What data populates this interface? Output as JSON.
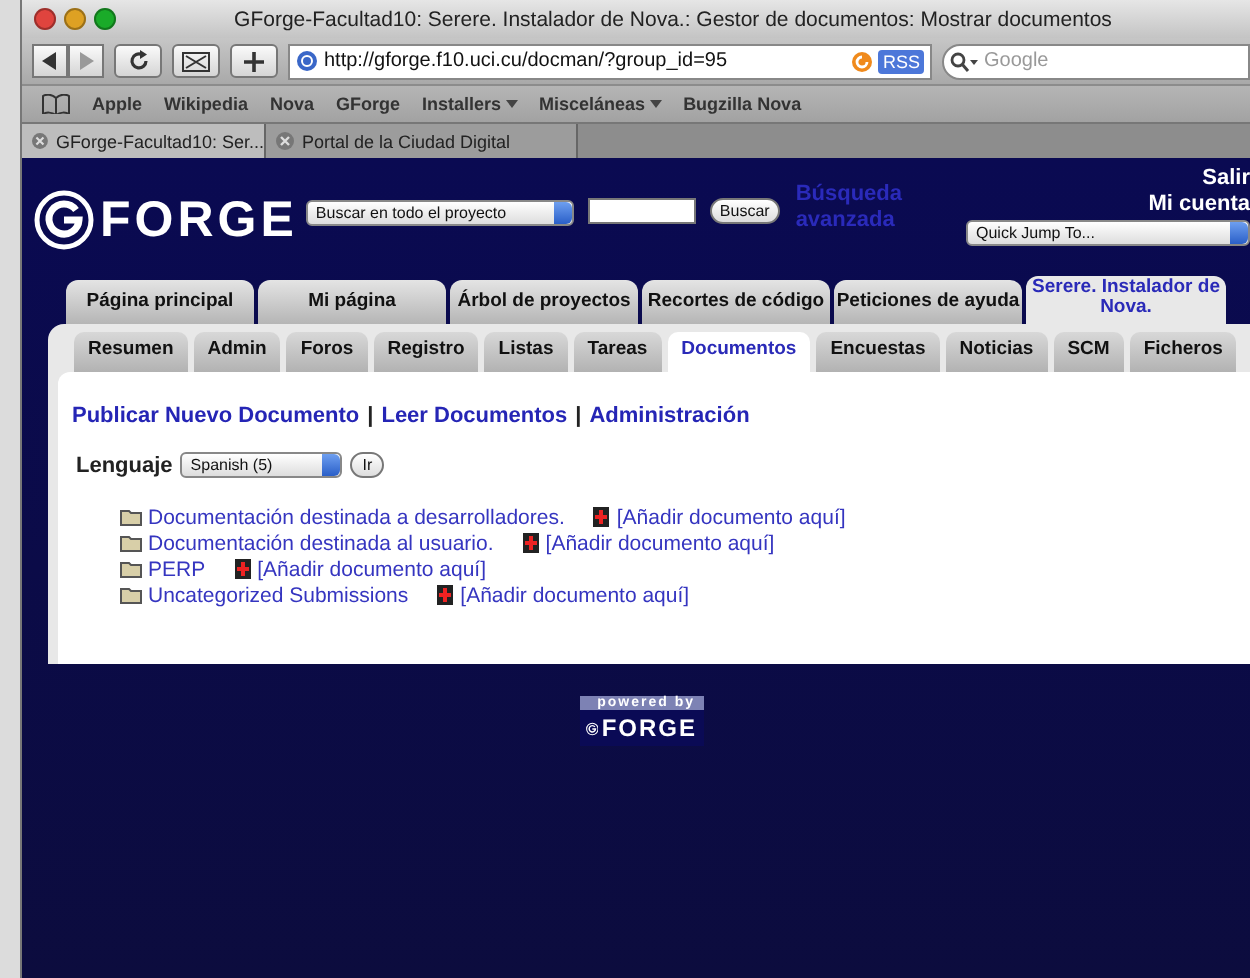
{
  "browser": {
    "title": "GForge-Facultad10: Serere. Instalador de Nova.: Gestor de documentos: Mostrar documentos",
    "url": "http://gforge.f10.uci.cu/docman/?group_id=95",
    "rss": "RSS",
    "search_placeholder": "Google",
    "bookmarks": [
      {
        "label": "Apple",
        "has_menu": false
      },
      {
        "label": "Wikipedia",
        "has_menu": false
      },
      {
        "label": "Nova",
        "has_menu": false
      },
      {
        "label": "GForge",
        "has_menu": false
      },
      {
        "label": "Installers",
        "has_menu": true
      },
      {
        "label": "Misceláneas",
        "has_menu": true
      },
      {
        "label": "Bugzilla Nova",
        "has_menu": false
      }
    ],
    "tabs": [
      {
        "label": "GForge-Facultad10: Ser...",
        "selected": true
      },
      {
        "label": "Portal de la Ciudad Digital",
        "selected": false
      }
    ]
  },
  "header": {
    "logo": "FORGE",
    "search_scope": "Buscar en todo el proyecto",
    "search_button": "Buscar",
    "advanced_search": "Búsqueda avanzada",
    "logout": "Salir",
    "account": "Mi cuenta",
    "quick_jump": "Quick Jump To..."
  },
  "main_tabs": [
    {
      "label": "Página principal",
      "selected": false
    },
    {
      "label": "Mi página",
      "selected": false
    },
    {
      "label": "Árbol de proyectos",
      "selected": false
    },
    {
      "label": "Recortes de código",
      "selected": false
    },
    {
      "label": "Peticiones de ayuda",
      "selected": false
    },
    {
      "label": "Serere. Instalador de Nova.",
      "selected": true
    }
  ],
  "sub_tabs": [
    {
      "label": "Resumen",
      "selected": false
    },
    {
      "label": "Admin",
      "selected": false
    },
    {
      "label": "Foros",
      "selected": false
    },
    {
      "label": "Registro",
      "selected": false
    },
    {
      "label": "Listas",
      "selected": false
    },
    {
      "label": "Tareas",
      "selected": false
    },
    {
      "label": "Documentos",
      "selected": true
    },
    {
      "label": "Encuestas",
      "selected": false
    },
    {
      "label": "Noticias",
      "selected": false
    },
    {
      "label": "SCM",
      "selected": false
    },
    {
      "label": "Ficheros",
      "selected": false
    }
  ],
  "actions": [
    {
      "kind": "link",
      "text": "Publicar Nuevo Documento"
    },
    {
      "kind": "separator",
      "text": "|"
    },
    {
      "kind": "link",
      "text": "Leer Documentos"
    },
    {
      "kind": "separator",
      "text": "|"
    },
    {
      "kind": "link",
      "text": "Administración"
    }
  ],
  "language": {
    "label": "Lenguaje",
    "value": "Spanish (5)",
    "button": "Ir"
  },
  "folders": [
    {
      "name": "Documentación destinada a desarrolladores.",
      "add_link": "[Añadir documento aquí]"
    },
    {
      "name": "Documentación destinada al usuario.",
      "add_link": "[Añadir documento aquí]"
    },
    {
      "name": "PERP",
      "add_link": "[Añadir documento aquí]"
    },
    {
      "name": "Uncategorized Submissions",
      "add_link": "[Añadir documento aquí]"
    }
  ],
  "footer": {
    "powered_by": "powered by",
    "logo": "FORGE"
  }
}
